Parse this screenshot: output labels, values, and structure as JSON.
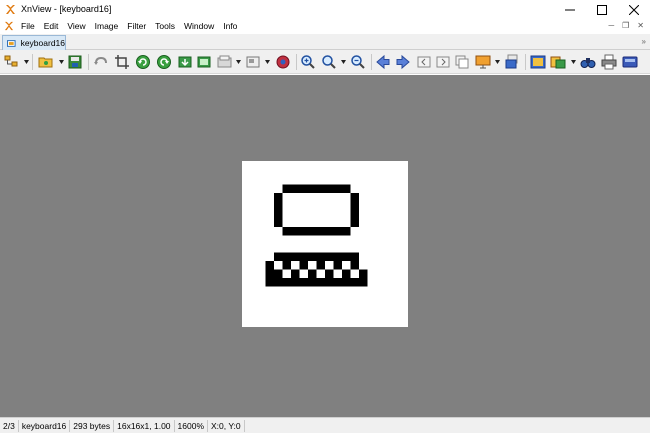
{
  "window": {
    "title": "XnView - [keyboard16]"
  },
  "menubar": {
    "items": [
      "File",
      "Edit",
      "View",
      "Image",
      "Filter",
      "Tools",
      "Window",
      "Info"
    ]
  },
  "tabbar": {
    "active_tab": "keyboard16"
  },
  "toolbar": {
    "buttons": [
      "browse-tree-icon",
      "open-folder-icon",
      "save-icon",
      "undo-icon",
      "crop-icon",
      "rotate-left-icon",
      "rotate-right-icon",
      "import-icon",
      "slideshow-icon",
      "print-preview-icon",
      "resize-icon",
      "zoom-in-icon",
      "zoom-search-icon",
      "zoom-out-icon",
      "previous-arrow-icon",
      "next-arrow-icon",
      "first-page-icon",
      "last-page-icon",
      "copy-icon",
      "presentation-icon",
      "duplicate-icon",
      "fullscreen-icon",
      "convert-icon",
      "find-icon",
      "print-icon",
      "scanner-icon"
    ]
  },
  "image": {
    "name": "keyboard16",
    "background": "#808080"
  },
  "statusbar": {
    "index": "2/3",
    "filename": "keyboard16",
    "filesize": "293 bytes",
    "dimensions": "16x16x1, 1.00",
    "zoom": "1600%",
    "cursor": "X:0, Y:0"
  }
}
